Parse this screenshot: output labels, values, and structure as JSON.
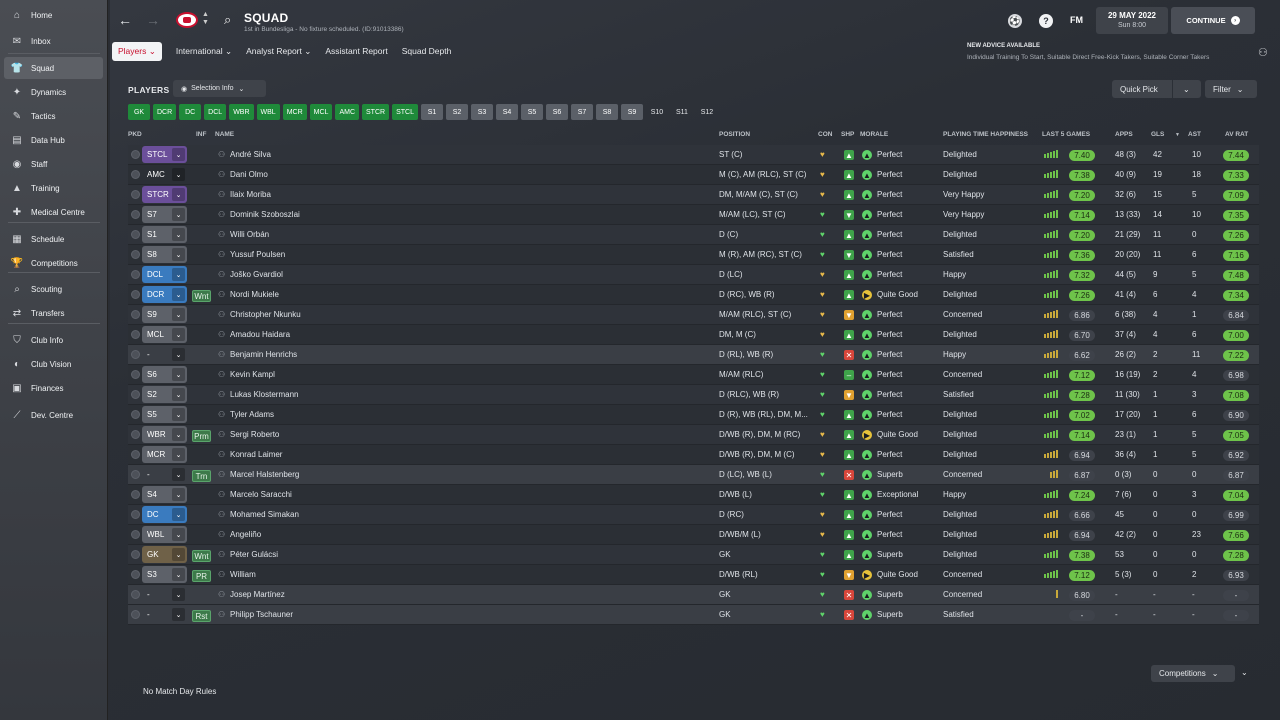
{
  "sidebar": {
    "items": [
      {
        "label": "Home",
        "icon": "home-icon",
        "glyph": "⌂"
      },
      {
        "label": "Inbox",
        "icon": "inbox-icon",
        "glyph": "✉"
      },
      {
        "label": "Squad",
        "icon": "shirt-icon",
        "glyph": "👕"
      },
      {
        "label": "Dynamics",
        "icon": "dynamics-icon",
        "glyph": "✦"
      },
      {
        "label": "Tactics",
        "icon": "tactics-icon",
        "glyph": "✎"
      },
      {
        "label": "Data Hub",
        "icon": "chart-icon",
        "glyph": "▤"
      },
      {
        "label": "Staff",
        "icon": "staff-icon",
        "glyph": "◉"
      },
      {
        "label": "Training",
        "icon": "training-icon",
        "glyph": "▲"
      },
      {
        "label": "Medical Centre",
        "icon": "medical-icon",
        "glyph": "✚"
      },
      {
        "label": "Schedule",
        "icon": "calendar-icon",
        "glyph": "▦"
      },
      {
        "label": "Competitions",
        "icon": "trophy-icon",
        "glyph": "🏆"
      },
      {
        "label": "Scouting",
        "icon": "scouting-icon",
        "glyph": "⌕"
      },
      {
        "label": "Transfers",
        "icon": "transfers-icon",
        "glyph": "⇄"
      },
      {
        "label": "Club Info",
        "icon": "shield-icon",
        "glyph": "⛉"
      },
      {
        "label": "Club Vision",
        "icon": "vision-icon",
        "glyph": "◐"
      },
      {
        "label": "Finances",
        "icon": "finances-icon",
        "glyph": "▣"
      },
      {
        "label": "Dev. Centre",
        "icon": "dev-centre-icon",
        "glyph": "⟋"
      }
    ]
  },
  "header": {
    "title": "SQUAD",
    "subtitle": "1st in Bundesliga - No fixture scheduled. (ID:91013386)",
    "fm_label": "FM",
    "date": "29 MAY 2022",
    "time": "Sun 8:00",
    "continue_label": "CONTINUE"
  },
  "subtabs": [
    "Players",
    "International",
    "Analyst Report",
    "Assistant Report",
    "Squad Depth"
  ],
  "advice": {
    "title": "NEW ADVICE AVAILABLE",
    "text": "Individual Training To Start, Suitable Direct Free-Kick Takers, Suitable Corner Takers"
  },
  "toolbar": {
    "players_label": "PLAYERS",
    "selection_info": "Selection Info",
    "quick_pick": "Quick Pick",
    "filter": "Filter"
  },
  "position_chips": {
    "green": [
      "GK",
      "DCR",
      "DC",
      "DCL",
      "WBR",
      "WBL",
      "MCR",
      "MCL",
      "AMC",
      "STCR",
      "STCL"
    ],
    "grey": [
      "S1",
      "S2",
      "S3",
      "S4",
      "S5",
      "S6",
      "S7",
      "S8",
      "S9"
    ],
    "plain": [
      "S10",
      "S11",
      "S12"
    ]
  },
  "columns": {
    "pkd": "PKD",
    "inf": "INF",
    "name": "NAME",
    "position": "POSITION",
    "con": "CON",
    "shp": "SHP",
    "morale": "MORALE",
    "pth": "PLAYING TIME HAPPINESS",
    "last5": "LAST 5 GAMES",
    "apps": "APPS",
    "gls": "GLS",
    "sort": "▼",
    "ast": "AST",
    "avrat": "AV RAT"
  },
  "players": [
    {
      "pos_badge": "STCL",
      "badge_color": "purple",
      "inf": "",
      "name": "André Silva",
      "position": "ST (C)",
      "con": "gold",
      "shp": "up",
      "morale_icon": "up",
      "morale": "Perfect",
      "pth": "Delighted",
      "bars": 5,
      "last5": "7.40",
      "last5_hi": true,
      "apps": "48 (3)",
      "gls": "42",
      "ast": "10",
      "avrat": "7.44",
      "avrat_hi": true
    },
    {
      "pos_badge": "AMC",
      "badge_color": "none",
      "inf": "",
      "name": "Dani Olmo",
      "position": "M (C), AM (RLC), ST (C)",
      "con": "gold",
      "shp": "up",
      "morale_icon": "up",
      "morale": "Perfect",
      "pth": "Delighted",
      "bars": 5,
      "last5": "7.38",
      "last5_hi": true,
      "apps": "40 (9)",
      "gls": "19",
      "ast": "18",
      "avrat": "7.33",
      "avrat_hi": true
    },
    {
      "pos_badge": "STCR",
      "badge_color": "purple",
      "inf": "",
      "name": "Ilaix Moriba",
      "position": "DM, M/AM (C), ST (C)",
      "con": "gold",
      "shp": "up",
      "morale_icon": "up",
      "morale": "Perfect",
      "pth": "Very Happy",
      "bars": 5,
      "last5": "7.20",
      "last5_hi": true,
      "apps": "32 (6)",
      "gls": "15",
      "ast": "5",
      "avrat": "7.09",
      "avrat_hi": true
    },
    {
      "pos_badge": "S7",
      "badge_color": "grey",
      "inf": "",
      "name": "Dominik Szoboszlai",
      "position": "M/AM (LC), ST (C)",
      "con": "green",
      "shp": "down",
      "morale_icon": "up",
      "morale": "Perfect",
      "pth": "Very Happy",
      "bars": 5,
      "last5": "7.14",
      "last5_hi": true,
      "apps": "13 (33)",
      "gls": "14",
      "ast": "10",
      "avrat": "7.35",
      "avrat_hi": true
    },
    {
      "pos_badge": "S1",
      "badge_color": "grey",
      "inf": "",
      "name": "Willi Orbán",
      "position": "D (C)",
      "con": "green",
      "shp": "up",
      "morale_icon": "up",
      "morale": "Perfect",
      "pth": "Delighted",
      "bars": 5,
      "last5": "7.20",
      "last5_hi": true,
      "apps": "21 (29)",
      "gls": "11",
      "ast": "0",
      "avrat": "7.26",
      "avrat_hi": true
    },
    {
      "pos_badge": "S8",
      "badge_color": "grey",
      "inf": "",
      "name": "Yussuf Poulsen",
      "position": "M (R), AM (RC), ST (C)",
      "con": "green",
      "shp": "down",
      "morale_icon": "up",
      "morale": "Perfect",
      "pth": "Satisfied",
      "bars": 5,
      "last5": "7.36",
      "last5_hi": true,
      "apps": "20 (20)",
      "gls": "11",
      "ast": "6",
      "avrat": "7.16",
      "avrat_hi": true
    },
    {
      "pos_badge": "DCL",
      "badge_color": "blue",
      "inf": "",
      "name": "Joško Gvardiol",
      "position": "D (LC)",
      "con": "gold",
      "shp": "up",
      "morale_icon": "up",
      "morale": "Perfect",
      "pth": "Happy",
      "bars": 5,
      "last5": "7.32",
      "last5_hi": true,
      "apps": "44 (5)",
      "gls": "9",
      "ast": "5",
      "avrat": "7.48",
      "avrat_hi": true
    },
    {
      "pos_badge": "DCR",
      "badge_color": "blue",
      "inf": "Wnt",
      "name": "Nordi Mukiele",
      "position": "D (RC), WB (R)",
      "con": "gold",
      "shp": "up",
      "morale_icon": "right",
      "morale": "Quite Good",
      "pth": "Delighted",
      "bars": 5,
      "last5": "7.26",
      "last5_hi": true,
      "apps": "41 (4)",
      "gls": "6",
      "ast": "4",
      "avrat": "7.34",
      "avrat_hi": true
    },
    {
      "pos_badge": "S9",
      "badge_color": "grey",
      "inf": "",
      "name": "Christopher Nkunku",
      "position": "M/AM (RLC), ST (C)",
      "con": "gold",
      "shp": "down-orange",
      "morale_icon": "up",
      "morale": "Perfect",
      "pth": "Concerned",
      "bars": 5,
      "last5": "6.86",
      "last5_hi": false,
      "apps": "6 (38)",
      "gls": "4",
      "ast": "1",
      "avrat": "6.84",
      "avrat_hi": false
    },
    {
      "pos_badge": "MCL",
      "badge_color": "grey",
      "inf": "",
      "name": "Amadou Haidara",
      "position": "DM, M (C)",
      "con": "gold",
      "shp": "up",
      "morale_icon": "up",
      "morale": "Perfect",
      "pth": "Delighted",
      "bars": 5,
      "last5": "6.70",
      "last5_hi": false,
      "apps": "37 (4)",
      "gls": "4",
      "ast": "6",
      "avrat": "7.00",
      "avrat_hi": true
    },
    {
      "pos_badge": "-",
      "badge_color": "none",
      "inf": "",
      "name": "Benjamin Henrichs",
      "position": "D (RL), WB (R)",
      "con": "green",
      "shp": "x",
      "morale_icon": "up",
      "morale": "Perfect",
      "pth": "Happy",
      "bars": 5,
      "last5": "6.62",
      "last5_hi": false,
      "apps": "26 (2)",
      "gls": "2",
      "ast": "11",
      "avrat": "7.22",
      "avrat_hi": true
    },
    {
      "pos_badge": "S6",
      "badge_color": "grey",
      "inf": "",
      "name": "Kevin Kampl",
      "position": "M/AM (RLC)",
      "con": "green",
      "shp": "flat",
      "morale_icon": "up",
      "morale": "Perfect",
      "pth": "Concerned",
      "bars": 5,
      "last5": "7.12",
      "last5_hi": true,
      "apps": "16 (19)",
      "gls": "2",
      "ast": "4",
      "avrat": "6.98",
      "avrat_hi": false
    },
    {
      "pos_badge": "S2",
      "badge_color": "grey",
      "inf": "",
      "name": "Lukas Klostermann",
      "position": "D (RLC), WB (R)",
      "con": "green",
      "shp": "down-orange",
      "morale_icon": "up",
      "morale": "Perfect",
      "pth": "Satisfied",
      "bars": 5,
      "last5": "7.28",
      "last5_hi": true,
      "apps": "11 (30)",
      "gls": "1",
      "ast": "3",
      "avrat": "7.08",
      "avrat_hi": true
    },
    {
      "pos_badge": "S5",
      "badge_color": "grey",
      "inf": "",
      "name": "Tyler Adams",
      "position": "D (R), WB (RL), DM, M...",
      "con": "green",
      "shp": "up",
      "morale_icon": "up",
      "morale": "Perfect",
      "pth": "Delighted",
      "bars": 5,
      "last5": "7.02",
      "last5_hi": true,
      "apps": "17 (20)",
      "gls": "1",
      "ast": "6",
      "avrat": "6.90",
      "avrat_hi": false
    },
    {
      "pos_badge": "WBR",
      "badge_color": "grey",
      "inf": "Prm",
      "name": "Sergi Roberto",
      "position": "D/WB (R), DM, M (RC)",
      "con": "gold",
      "shp": "up",
      "morale_icon": "right",
      "morale": "Quite Good",
      "pth": "Delighted",
      "bars": 5,
      "last5": "7.14",
      "last5_hi": true,
      "apps": "23 (1)",
      "gls": "1",
      "ast": "5",
      "avrat": "7.05",
      "avrat_hi": true
    },
    {
      "pos_badge": "MCR",
      "badge_color": "grey",
      "inf": "",
      "name": "Konrad Laimer",
      "position": "D/WB (R), DM, M (C)",
      "con": "gold",
      "shp": "up",
      "morale_icon": "up",
      "morale": "Perfect",
      "pth": "Delighted",
      "bars": 5,
      "last5": "6.94",
      "last5_hi": false,
      "apps": "36 (4)",
      "gls": "1",
      "ast": "5",
      "avrat": "6.92",
      "avrat_hi": false
    },
    {
      "pos_badge": "-",
      "badge_color": "none",
      "inf": "Trn",
      "name": "Marcel Halstenberg",
      "position": "D (LC), WB (L)",
      "con": "green",
      "shp": "x",
      "morale_icon": "up",
      "morale": "Superb",
      "pth": "Concerned",
      "bars": 3,
      "last5": "6.87",
      "last5_hi": false,
      "apps": "0 (3)",
      "gls": "0",
      "ast": "0",
      "avrat": "6.87",
      "avrat_hi": false
    },
    {
      "pos_badge": "S4",
      "badge_color": "grey",
      "inf": "",
      "name": "Marcelo Saracchi",
      "position": "D/WB (L)",
      "con": "green",
      "shp": "up",
      "morale_icon": "up",
      "morale": "Exceptional",
      "pth": "Happy",
      "bars": 5,
      "last5": "7.24",
      "last5_hi": true,
      "apps": "7 (6)",
      "gls": "0",
      "ast": "3",
      "avrat": "7.04",
      "avrat_hi": true
    },
    {
      "pos_badge": "DC",
      "badge_color": "blue",
      "inf": "",
      "name": "Mohamed Simakan",
      "position": "D (RC)",
      "con": "gold",
      "shp": "up",
      "morale_icon": "up",
      "morale": "Perfect",
      "pth": "Delighted",
      "bars": 5,
      "last5": "6.66",
      "last5_hi": false,
      "apps": "45",
      "gls": "0",
      "ast": "0",
      "avrat": "6.99",
      "avrat_hi": false
    },
    {
      "pos_badge": "WBL",
      "badge_color": "grey",
      "inf": "",
      "name": "Angeliño",
      "position": "D/WB/M (L)",
      "con": "gold",
      "shp": "up",
      "morale_icon": "up",
      "morale": "Perfect",
      "pth": "Delighted",
      "bars": 5,
      "last5": "6.94",
      "last5_hi": false,
      "apps": "42 (2)",
      "gls": "0",
      "ast": "23",
      "avrat": "7.66",
      "avrat_hi": true
    },
    {
      "pos_badge": "GK",
      "badge_color": "brown",
      "inf": "Wnt",
      "name": "Péter Gulácsi",
      "position": "GK",
      "con": "green",
      "shp": "up",
      "morale_icon": "up",
      "morale": "Superb",
      "pth": "Delighted",
      "bars": 5,
      "last5": "7.38",
      "last5_hi": true,
      "apps": "53",
      "gls": "0",
      "ast": "0",
      "avrat": "7.28",
      "avrat_hi": true
    },
    {
      "pos_badge": "S3",
      "badge_color": "grey",
      "inf": "PR",
      "name": "William",
      "position": "D/WB (RL)",
      "con": "green",
      "shp": "down-orange",
      "morale_icon": "right",
      "morale": "Quite Good",
      "pth": "Concerned",
      "bars": 5,
      "last5": "7.12",
      "last5_hi": true,
      "apps": "5 (3)",
      "gls": "0",
      "ast": "2",
      "avrat": "6.93",
      "avrat_hi": false
    },
    {
      "pos_badge": "-",
      "badge_color": "none",
      "inf": "",
      "name": "Josep Martínez",
      "position": "GK",
      "con": "green",
      "shp": "x",
      "morale_icon": "up",
      "morale": "Superb",
      "pth": "Concerned",
      "bars": 1,
      "last5": "6.80",
      "last5_hi": false,
      "apps": "-",
      "gls": "-",
      "ast": "-",
      "avrat": "-",
      "avrat_hi": false
    },
    {
      "pos_badge": "-",
      "badge_color": "none",
      "inf": "Rst",
      "name": "Philipp Tschauner",
      "position": "GK",
      "con": "green",
      "shp": "x",
      "morale_icon": "up",
      "morale": "Superb",
      "pth": "Satisfied",
      "bars": 0,
      "last5": "-",
      "last5_hi": false,
      "apps": "-",
      "gls": "-",
      "ast": "-",
      "avrat": "-",
      "avrat_hi": false
    }
  ],
  "footer": {
    "match_day_rules": "No Match Day Rules",
    "competitions": "Competitions"
  },
  "colors": {
    "accent_red": "#c8102e",
    "chip_green": "#1f8a3a",
    "rating_green": "#6ec34a",
    "badge_purple": "#6b4f9a",
    "badge_blue": "#3a7bbf"
  }
}
